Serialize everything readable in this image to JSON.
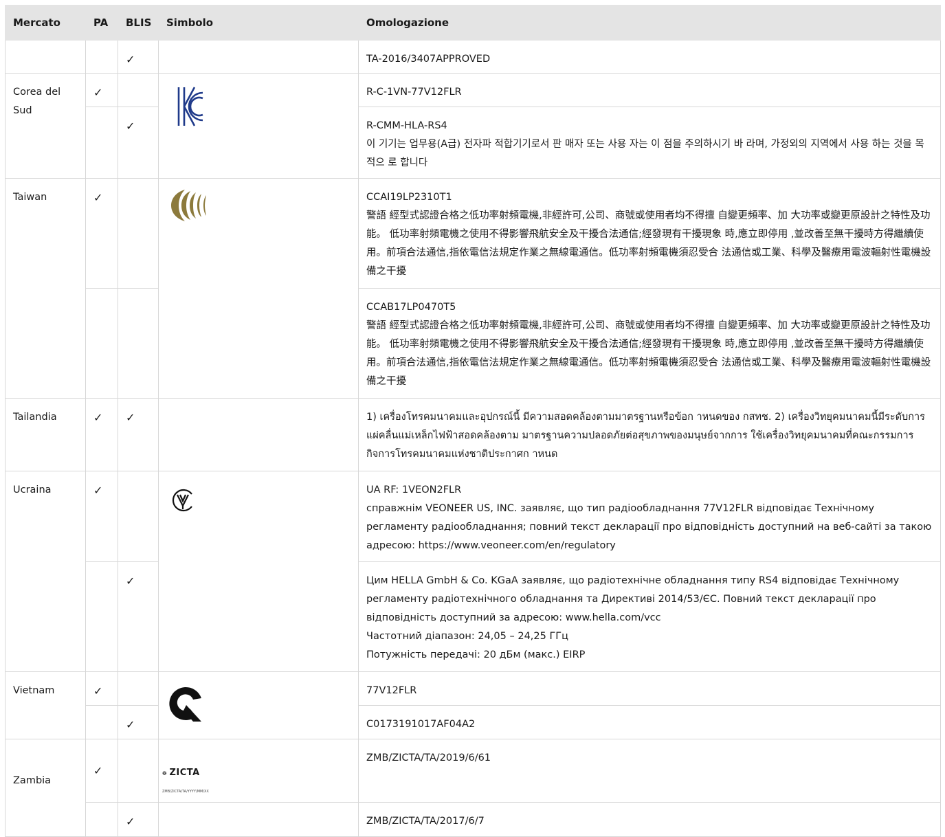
{
  "headers": {
    "mercato": "Mercato",
    "pa": "PA",
    "blis": "BLIS",
    "simbolo": "Simbolo",
    "omologazione": "Omologazione"
  },
  "check": "✓",
  "rows": {
    "first": {
      "omologazione": "TA-2016/3407APPROVED"
    },
    "korea": {
      "mercato": "Corea del Sud",
      "symbol_icon": "kc-mark-icon",
      "pa_omologazione": "R-C-1VN-77V12FLR",
      "blis_omologazione": [
        "R-CMM-HLA-RS4",
        "이 기기는 업무용(A급) 전자파 적합기기로서 판 매자 또는 사용 자는 이 점을 주의하시기 바 라며, 가정외의 지역에서 사용 하는 것을 목적으 로 합니다"
      ]
    },
    "taiwan": {
      "mercato": "Taiwan",
      "symbol_icon": "ncc-mark-icon",
      "pa_omologazione": [
        "CCAI19LP2310T1",
        "警語 經型式認證合格之低功率射頻電機,非經許可,公司、商號或使用者均不得擅 自變更頻率、加 大功率或變更原設計之特性及功能。 低功率射頻電機之使用不得影響飛航安全及干擾合法通信;經發現有干擾現象 時,應立即停用 ,並改善至無干擾時方得繼續使用。前項合法通信,指依電信法規定作業之無線電通信。低功率射頻電機須忍受合 法通信或工業、科學及醫療用電波輻射性電機設備之干擾"
      ],
      "blis_omologazione": [
        "CCAB17LP0470T5",
        "警語 經型式認證合格之低功率射頻電機,非經許可,公司、商號或使用者均不得擅 自變更頻率、加 大功率或變更原設計之特性及功能。 低功率射頻電機之使用不得影響飛航安全及干擾合法通信;經發現有干擾現象 時,應立即停用 ,並改善至無干擾時方得繼續使用。前項合法通信,指依電信法規定作業之無線電通信。低功率射頻電機須忍受合 法通信或工業、科學及醫療用電波輻射性電機設備之干擾"
      ]
    },
    "thailand": {
      "mercato": "Tailandia",
      "omologazione": "1) เครื่องโทรคมนาคมและอุปกรณ์นี้ มีความสอดคล้องตามมาตรฐานหรือข้อก าหนดของ กสทช. 2) เครื่องวิทยุคมนาคมนี้มีระดับการแผ่คลื่นแม่เหล็กไฟฟ้าสอดคล้องตาม มาตรฐานความปลอดภัยต่อสุขภาพของมนุษย์จากการ ใช้เครื่องวิทยุคมนาคมที่คณะกรรมการกิจการโทรคมนาคมแห่งชาติประกาศก าหนด"
    },
    "ukraine": {
      "mercato": "Ucraina",
      "symbol_icon": "ukrsepro-mark-icon",
      "pa_omologazione": [
        "UA RF: 1VEON2FLR",
        "справжнім VEONEER US, INC. заявляє, що тип радіообладнання 77V12FLR відповідає Технічному регламенту радіообладнання; повний текст декларації про відповідність доступний на веб-сайті за такою адресою: https://www.veoneer.com/en/regulatory"
      ],
      "blis_omologazione": [
        "Цим HELLA GmbH & Co. KGaA заявляє, що радіотехнічне обладнання типу RS4 відповідає Технічному регламенту радіотехнічного обладнання та Директиві 2014/53/ЄС. Повний текст декларації про відповідність доступний за адресою: www.hella.com/vcc",
        "Частотний діапазон: 24,05 – 24,25 ГГц",
        "Потужність передачі: 20 дБм (макс.) EIRP"
      ]
    },
    "vietnam": {
      "mercato": "Vietnam",
      "symbol_icon": "cr-mark-icon",
      "pa_omologazione": "77V12FLR",
      "blis_omologazione": "C0173191017AF04A2"
    },
    "zambia": {
      "mercato": "Zambia",
      "symbol_icon": "zicta-logo-icon",
      "logo_text": "ZICTA",
      "logo_subtext": "ZMB/ZICTA/TA/YYYY/MM/XX",
      "pa_omologazione": "ZMB/ZICTA/TA/2019/6/61",
      "blis_omologazione": "ZMB/ZICTA/TA/2017/6/7"
    }
  }
}
